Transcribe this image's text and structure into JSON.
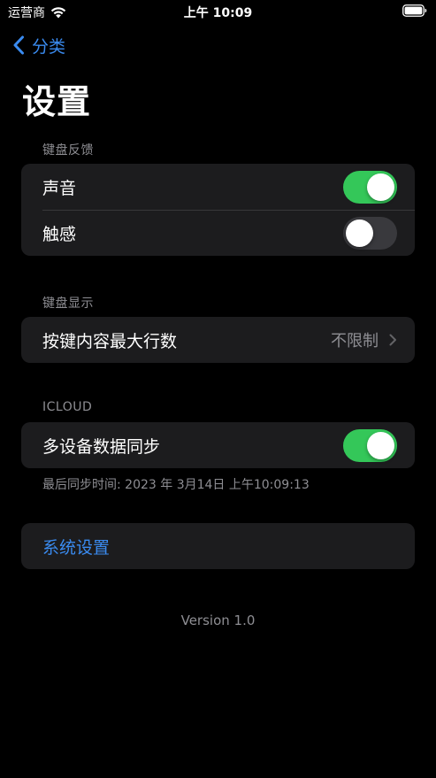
{
  "status_bar": {
    "carrier": "运营商",
    "time": "上午 10:09",
    "wifi_icon": "wifi-icon",
    "battery_icon": "battery-full-icon"
  },
  "nav": {
    "back_label": "分类",
    "back_icon": "chevron-left-icon"
  },
  "page": {
    "title": "设置"
  },
  "sections": {
    "keyboard_feedback": {
      "header": "键盘反馈",
      "sound": {
        "label": "声音",
        "on": true
      },
      "haptics": {
        "label": "触感",
        "on": false
      }
    },
    "keyboard_display": {
      "header": "键盘显示",
      "max_rows": {
        "label": "按键内容最大行数",
        "value": "不限制"
      }
    },
    "icloud": {
      "header": "ICLOUD",
      "sync": {
        "label": "多设备数据同步",
        "on": true
      },
      "footer": "最后同步时间: 2023 年 3月14日 上午10:09:13"
    },
    "system": {
      "label": "系统设置"
    }
  },
  "version": "Version 1.0",
  "colors": {
    "accent": "#3a8bf0",
    "toggle_on": "#34c759",
    "toggle_off": "#39393d",
    "cell_bg": "#1c1c1e",
    "secondary_text": "#8e8e93"
  }
}
